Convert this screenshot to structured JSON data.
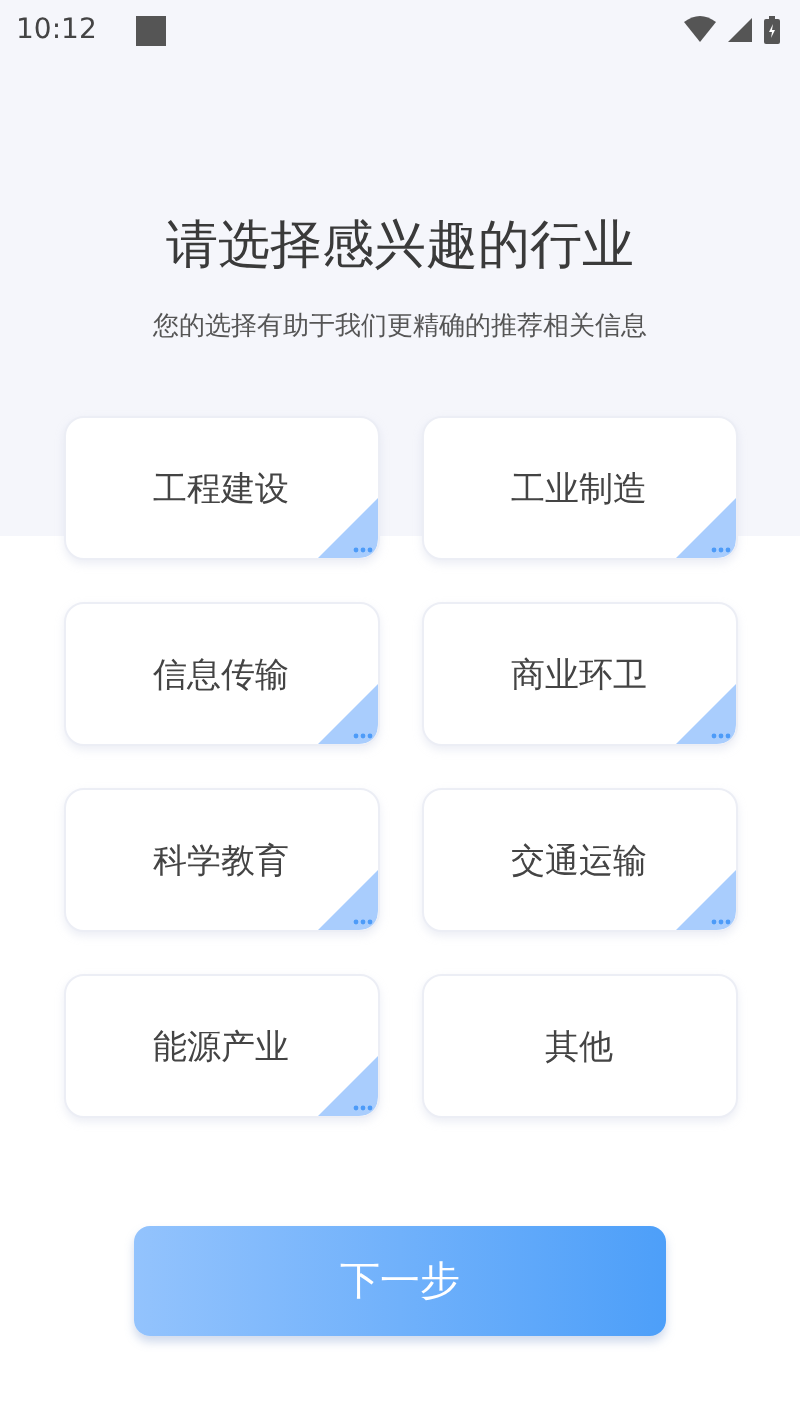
{
  "status_bar": {
    "time": "10:12"
  },
  "title": "请选择感兴趣的行业",
  "subtitle": "您的选择有助于我们更精确的推荐相关信息",
  "industries": [
    {
      "label": "工程建设",
      "selected": false,
      "has_more": true
    },
    {
      "label": "工业制造",
      "selected": false,
      "has_more": true
    },
    {
      "label": "信息传输",
      "selected": false,
      "has_more": true
    },
    {
      "label": "商业环卫",
      "selected": false,
      "has_more": true
    },
    {
      "label": "科学教育",
      "selected": false,
      "has_more": true
    },
    {
      "label": "交通运输",
      "selected": false,
      "has_more": true
    },
    {
      "label": "能源产业",
      "selected": false,
      "has_more": true
    },
    {
      "label": "其他",
      "selected": false,
      "has_more": false
    }
  ],
  "next_button": "下一步"
}
